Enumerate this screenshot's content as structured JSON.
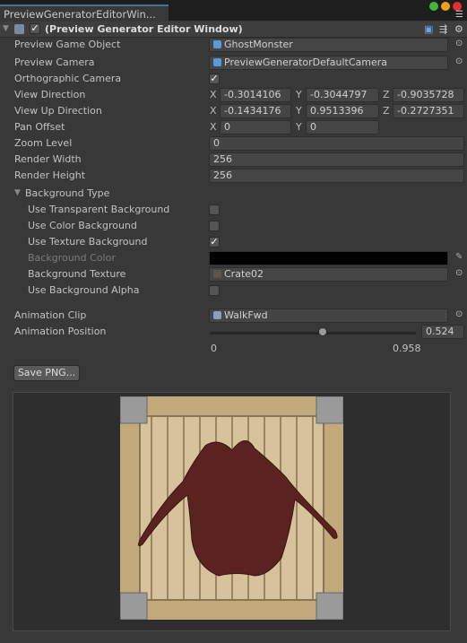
{
  "window": {
    "tab_title": "PreviewGeneratorEditorWin...",
    "traffic_lights": [
      "#3fb83f",
      "#f0a020",
      "#e03030"
    ]
  },
  "component": {
    "title": "(Preview Generator Editor Window)",
    "enabled": true
  },
  "fields": {
    "preview_game_object": {
      "label": "Preview Game Object",
      "value": "GhostMonster"
    },
    "preview_camera": {
      "label": "Preview Camera",
      "value": "PreviewGeneratorDefaultCamera"
    },
    "orthographic_camera": {
      "label": "Orthographic Camera",
      "checked": true
    },
    "view_direction": {
      "label": "View Direction",
      "x": "-0.3014106",
      "y": "-0.3044797",
      "z": "-0.9035728"
    },
    "view_up_direction": {
      "label": "View Up Direction",
      "x": "-0.1434176",
      "y": "0.9513396",
      "z": "-0.2727351"
    },
    "pan_offset": {
      "label": "Pan Offset",
      "x": "0",
      "y": "0"
    },
    "zoom_level": {
      "label": "Zoom Level",
      "value": "0"
    },
    "render_width": {
      "label": "Render Width",
      "value": "256"
    },
    "render_height": {
      "label": "Render Height",
      "value": "256"
    },
    "background_type": {
      "label": "Background Type",
      "expanded": true
    },
    "use_transparent": {
      "label": "Use Transparent Background",
      "checked": false
    },
    "use_color": {
      "label": "Use Color Background",
      "checked": false
    },
    "use_texture": {
      "label": "Use Texture Background",
      "checked": true
    },
    "background_color": {
      "label": "Background Color",
      "color": "#000000"
    },
    "background_texture": {
      "label": "Background Texture",
      "value": "Crate02"
    },
    "use_alpha": {
      "label": "Use Background Alpha",
      "checked": false
    },
    "animation_clip": {
      "label": "Animation Clip",
      "value": "WalkFwd"
    },
    "animation_position": {
      "label": "Animation Position",
      "value": "0.524",
      "min": "0",
      "max": "0.958"
    }
  },
  "axes": {
    "x": "X",
    "y": "Y",
    "z": "Z"
  },
  "save_button": "Save PNG..."
}
